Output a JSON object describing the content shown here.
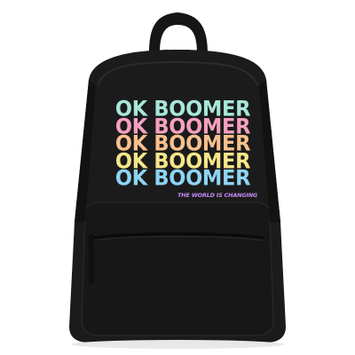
{
  "product": {
    "print_lines": [
      {
        "text": "OK BOOMER",
        "color": "#a7e7d9"
      },
      {
        "text": "OK BOOMER",
        "color": "#f6a0c0"
      },
      {
        "text": "OK BOOMER",
        "color": "#f9c18d"
      },
      {
        "text": "OK BOOMER",
        "color": "#f6e58a"
      },
      {
        "text": "OK BOOMER",
        "color": "#8ed4f4"
      }
    ],
    "tagline": {
      "text": "THE WORLD IS CHANGING",
      "color": "#c48cf5"
    },
    "bag_color": "#1b1b1b"
  }
}
